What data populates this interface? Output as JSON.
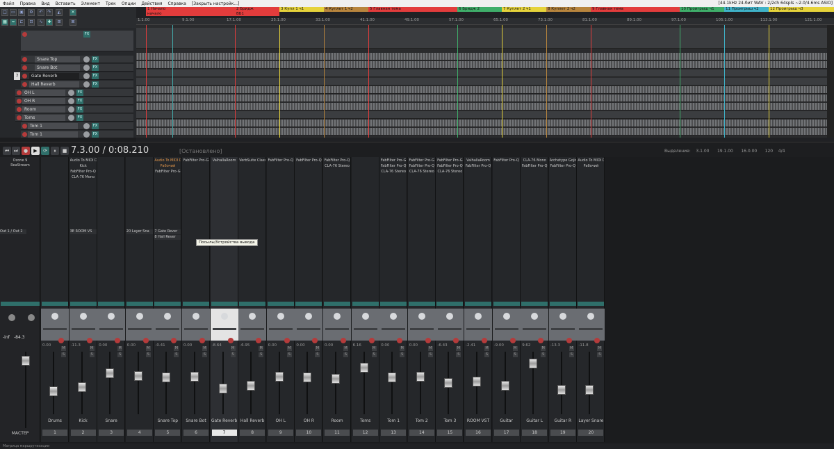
{
  "menu": {
    "items": [
      "Файл",
      "Правка",
      "Вид",
      "Вставить",
      "Элемент",
      "Трек",
      "Опции",
      "Действия",
      "Справка",
      "[Закрыть настройк...]"
    ],
    "status": "[44.1kHz 24-бит WAV : 2/2ch 64spls ~2.0/4.6ms ASIO]"
  },
  "markers": [
    {
      "label": "1 Начало",
      "color": "#e23c3c"
    },
    {
      "label": "2 Бридж",
      "color": "#e23c3c"
    },
    {
      "label": "3 Купл 1 ч1",
      "color": "#e6d33b"
    },
    {
      "label": "4 Куплет 1 ч2",
      "color": "#b8853d"
    },
    {
      "label": "5 Главная тема",
      "color": "#e23c3c"
    },
    {
      "label": "6 Бридж 2",
      "color": "#3fae6a"
    },
    {
      "label": "7 Куплет 2 ч1",
      "color": "#e6d33b"
    },
    {
      "label": "8 Куплет 2 ч2",
      "color": "#b8853d"
    },
    {
      "label": "9 Главная тема",
      "color": "#e23c3c"
    },
    {
      "label": "10 Проигрыш ч1",
      "color": "#3fae6a"
    },
    {
      "label": "11 Проигрыш ч2",
      "color": "#3fb2c8"
    },
    {
      "label": "12 Проигрыш ч3",
      "color": "#e6d33b"
    }
  ],
  "region_row": [
    "начало",
    "ВБ1"
  ],
  "ruler": [
    "1.1.00",
    "9.1.00",
    "17.1.00",
    "25.1.00",
    "33.1.00",
    "41.1.00",
    "49.1.00",
    "57.1.00",
    "65.1.00",
    "73.1.00",
    "81.1.00",
    "89.1.00",
    "97.1.00",
    "105.1.00",
    "113.1.00",
    "121.1.00"
  ],
  "tracks": [
    {
      "name": "Snare Top",
      "num": ""
    },
    {
      "name": "Snare Bot",
      "num": ""
    },
    {
      "name": "Gate Reverb",
      "num": "7"
    },
    {
      "name": "Hall Reverb",
      "num": ""
    },
    {
      "name": "OH L",
      "num": ""
    },
    {
      "name": "OH R",
      "num": ""
    },
    {
      "name": "Room",
      "num": ""
    },
    {
      "name": "Toms",
      "num": ""
    },
    {
      "name": "Tom 1",
      "num": ""
    },
    {
      "name": "Tom 1",
      "num": ""
    }
  ],
  "transport": {
    "time": "7.3.00 / 0:08.210",
    "state": "[Остановлено]",
    "selection_label": "Выделение:",
    "sel_start": "3.1.00",
    "sel_end": "19.1.00",
    "sel_len": "16.0.00",
    "bpm": "120",
    "sig": "4/4"
  },
  "master": {
    "label": "МАСТЕР",
    "fx": "Ozone 9",
    "fx2": "ReaStream",
    "route": "Out 1 / Out 2",
    "peak": "-inf",
    "db": "-84.3"
  },
  "tooltip": "Посылы/Устройства вывода",
  "status_bar": "Матрица маршрутизации",
  "strips": [
    {
      "name": "Drums",
      "num": "1",
      "fx": [],
      "send": "",
      "vol": "0.00",
      "fpos": 0.62
    },
    {
      "name": "Kick",
      "num": "2",
      "fx": [
        "Audio To MIDI Dr",
        "Kick",
        "FabFilter Pro-Q",
        "CLA-76 Mono"
      ],
      "send": "",
      "vol": "-11.3",
      "fpos": 0.55
    },
    {
      "name": "Snare",
      "num": "3",
      "fx": [],
      "send": "",
      "vol": "0.00",
      "fpos": 0.3
    },
    {
      "name": "",
      "num": "4",
      "fx": [],
      "send": "",
      "vol": "0.00",
      "fpos": 0.35
    },
    {
      "name": "Snare Top",
      "num": "5",
      "fx": [
        "Audio To MIDI Dr",
        "Рабочий",
        "FabFilter Pro-G"
      ],
      "send": "",
      "vol": "-0.41",
      "fpos": 0.38
    },
    {
      "name": "Snare Bot",
      "num": "6",
      "fx": [
        "FabFilter Pro-G"
      ],
      "send": "",
      "vol": "0.00",
      "fpos": 0.36
    },
    {
      "name": "Gate Reverb",
      "num": "7",
      "fx": [
        "ValhallaRoom"
      ],
      "send": "",
      "vol": "-8.64",
      "fpos": 0.58
    },
    {
      "name": "Hall Reverb",
      "num": "8",
      "fx": [
        "VerbSuite Classi"
      ],
      "send": "",
      "vol": "-6.95",
      "fpos": 0.52
    },
    {
      "name": "OH L",
      "num": "9",
      "fx": [
        "FabFilter Pro-Q"
      ],
      "send": "",
      "vol": "0.00",
      "fpos": 0.36
    },
    {
      "name": "OH R",
      "num": "10",
      "fx": [
        "FabFilter Pro-Q"
      ],
      "send": "",
      "vol": "0.00",
      "fpos": 0.38
    },
    {
      "name": "Room",
      "num": "11",
      "fx": [
        "FabFilter Pro-Q",
        "CLA-76 Stereo"
      ],
      "send": "",
      "vol": "0.00",
      "fpos": 0.4
    },
    {
      "name": "Toms",
      "num": "12",
      "fx": [],
      "send": "",
      "vol": "6.16",
      "fpos": 0.2
    },
    {
      "name": "Tom 1",
      "num": "13",
      "fx": [
        "FabFilter Pro-G",
        "FabFilter Pro-Q",
        "CLA-76 Stereo"
      ],
      "send": "",
      "vol": "0.00",
      "fpos": 0.38
    },
    {
      "name": "Tom 2",
      "num": "14",
      "fx": [
        "FabFilter Pro-G",
        "FabFilter Pro-Q",
        "CLA-76 Stereo"
      ],
      "send": "",
      "vol": "0.00",
      "fpos": 0.36
    },
    {
      "name": "Tom 3",
      "num": "15",
      "fx": [
        "FabFilter Pro-G",
        "FabFilter Pro-Q",
        "CLA-76 Stereo"
      ],
      "send": "",
      "vol": "-6.43",
      "fpos": 0.48
    },
    {
      "name": "ROOM VST",
      "num": "16",
      "fx": [
        "ValhallaRoom",
        "FabFilter Pro-Q"
      ],
      "send": "",
      "vol": "-2.41",
      "fpos": 0.45
    },
    {
      "name": "Guitar",
      "num": "17",
      "fx": [
        "FabFilter Pro-Q"
      ],
      "send": "",
      "vol": "-9.00",
      "fpos": 0.52
    },
    {
      "name": "Guitar L",
      "num": "18",
      "fx": [
        "CLA-76 Mono",
        "FabFilter Pro-Q"
      ],
      "send": "",
      "vol": "9.62",
      "fpos": 0.12
    },
    {
      "name": "Guitar R",
      "num": "19",
      "fx": [
        "Archetype Gojir",
        "FabFilter Pro-Q"
      ],
      "send": "",
      "vol": "-13.3",
      "fpos": 0.6
    },
    {
      "name": "Layer Snare",
      "num": "20",
      "fx": [
        "Audio To MIDI Dr",
        "Рабочий"
      ],
      "send": "",
      "vol": "-11.8",
      "fpos": 0.6
    }
  ],
  "sends": [
    {
      "strip": 1,
      "label": "3E ROOM VS"
    },
    {
      "strip": 3,
      "label": "20 Layer Sna"
    },
    {
      "strip": 4,
      "label": "7 Gate Rever"
    },
    {
      "strip": 4,
      "label": "8 Hall Rever"
    }
  ]
}
